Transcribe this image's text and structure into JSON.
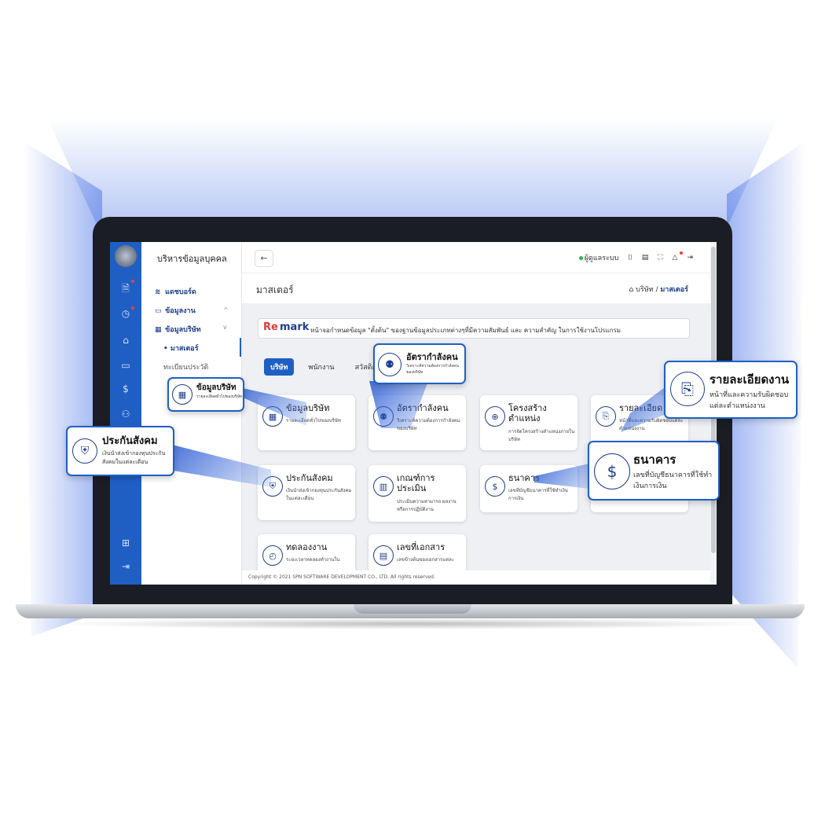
{
  "app": {
    "title": "บริหารข้อมูลบุคคล"
  },
  "sidebar": {
    "items": [
      {
        "label": "แดชบอร์ด",
        "icon": "layers-icon"
      },
      {
        "label": "ข้อมูลงาน",
        "icon": "laptop-icon"
      },
      {
        "label": "ข้อมูลบริษัท",
        "icon": "building-icon"
      }
    ],
    "sub_active": "• มาสเตอร์",
    "sub_other": "ทะเบียนประวัติ"
  },
  "topbar": {
    "status_label": "ผู้ดูแลระบบ",
    "back_icon": "←"
  },
  "page": {
    "title": "มาสเตอร์",
    "crumb_home": "บริษัท",
    "crumb_sep": "/",
    "crumb_current": "มาสเตอร์"
  },
  "remark": {
    "re": "Re",
    "mark": "mark",
    "text": "หน้าจอกำหนดข้อมูล \"ตั้งต้น\" ของฐานข้อมูลประเภทต่างๆที่มีความสัมพันธ์ และ ความสำคัญ ในการใช้งานโปรแกรม"
  },
  "tabs": [
    {
      "label": "บริษัท"
    },
    {
      "label": "พนักงาน"
    },
    {
      "label": "สวัสดิการ"
    }
  ],
  "cards": [
    {
      "title": "ข้อมูลบริษัท",
      "desc": "รายละเอียดทั่วไปของบริษัท"
    },
    {
      "title": "อัตรากำลังคน",
      "desc": "วิเคราะห์ความต้องการกำลังคนของบริษัท"
    },
    {
      "title": "โครงสร้างตำแหน่ง",
      "desc": "การจัดโครงสร้างตำแหน่งภายในบริษัท"
    },
    {
      "title": "รายละเอียด",
      "desc": "หน้าที่และความรับผิดชอบแต่ละตำแหน่งงาน"
    },
    {
      "title": "ประกันสังคม",
      "desc": "เงินนำส่งเข้ากองทุนประกันสังคมในแต่ละเดือน"
    },
    {
      "title": "เกณฑ์การประเมิน",
      "desc": "ประเมินความสามารถ ผลงาน หรือการปฏิบัติงาน"
    },
    {
      "title": "ธนาคาร",
      "desc": "เลขที่บัญชีธนาคารที่ใช้ทำเงินการเงิน"
    },
    {
      "title": "ทดลองงาน",
      "desc": "ระยะเวลาทดลองทำงานใน"
    },
    {
      "title": "เลขที่เอกสาร",
      "desc": "เลขข้างต้นของเอกสารแต่ละ"
    }
  ],
  "callouts": [
    {
      "title": "ข้อมูลบริษัท",
      "desc": "รายละเอียดทั่วไปของบริษัท"
    },
    {
      "title": "อัตรากำลังคน",
      "desc": "วิเคราะห์ความต้องการกำลังคนของบริษัท"
    },
    {
      "title": "รายละเอียดงาน",
      "desc": "หน้าที่และความรับผิดชอบแต่ละตำแหน่งงาน"
    },
    {
      "title": "ประกันสังคม",
      "desc": "เงินนำส่งเข้ากองทุนประกันสังคมในแต่ละเดือน"
    },
    {
      "title": "ธนาคาร",
      "desc": "เลขที่บัญชีธนาคารที่ใช้ทำเงินการเงิน"
    }
  ],
  "footer": {
    "text": "Copyright © 2021 SPN SOFTWARE DEVELOPMENT CO., LTD. All rights reserved."
  },
  "colors": {
    "brand": "#1f5fc4",
    "remark_red": "#e03a3a",
    "online": "#2bb34d"
  }
}
